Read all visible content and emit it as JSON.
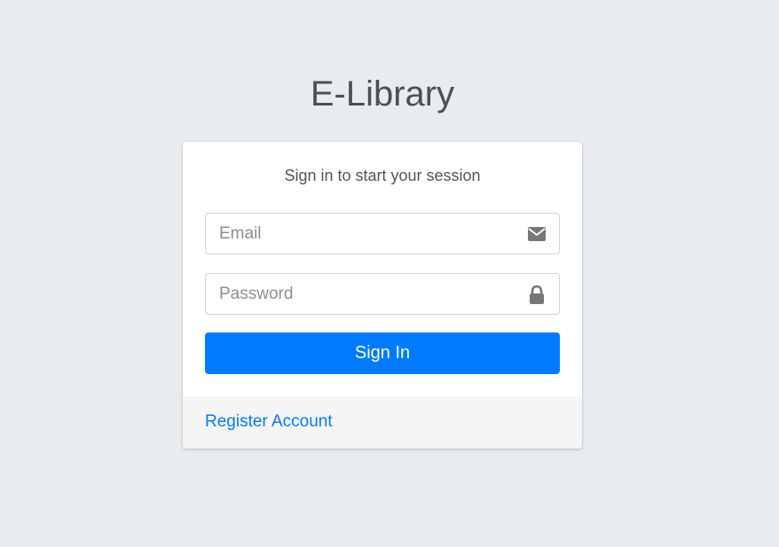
{
  "brand": {
    "bold": "E-",
    "light": "Library"
  },
  "login": {
    "message": "Sign in to start your session",
    "email_placeholder": "Email",
    "email_value": "",
    "password_placeholder": "Password",
    "password_value": "",
    "submit_label": "Sign In",
    "register_label": "Register Account"
  },
  "icons": {
    "email": "envelope-icon",
    "password": "lock-icon"
  },
  "colors": {
    "background": "#e9ecef",
    "primary": "#007bff",
    "card": "#ffffff",
    "footer": "#f5f5f5",
    "icon": "#777777"
  }
}
